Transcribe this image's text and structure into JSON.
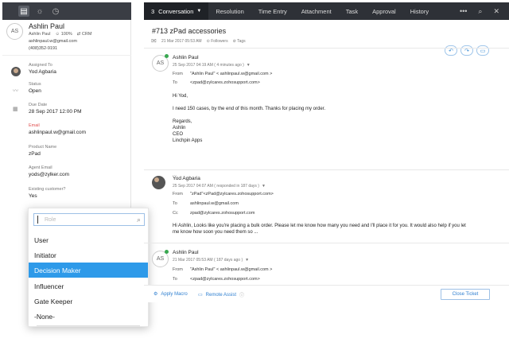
{
  "topbar": {
    "left_icons": [
      "ticket-icon",
      "bulb-icon",
      "history-icon"
    ],
    "tabs": [
      {
        "count": "3",
        "label": "Conversation",
        "active": true
      },
      {
        "label": "Resolution"
      },
      {
        "label": "Time Entry"
      },
      {
        "label": "Attachment"
      },
      {
        "label": "Task"
      },
      {
        "label": "Approval"
      },
      {
        "label": "History"
      }
    ],
    "more_icon": "•••",
    "search_icon": "⌕",
    "close_icon": "✕"
  },
  "customer": {
    "initials": "AS",
    "name": "Ashlin Paul",
    "short_name": "Ashlin Paul",
    "score": "100%",
    "crm": "CRM",
    "email": "ashlinpaul.w@gmail.com",
    "phone": "(408)352-9191"
  },
  "fields": [
    {
      "label": "Assigned To",
      "value": "Yod Agbaria"
    },
    {
      "label": "Status",
      "value": "Open"
    },
    {
      "label": "Due Date",
      "value": "28 Sep 2017 12:00 PM"
    },
    {
      "label": "Email",
      "value": "ashlinpaul.w@gmail.com"
    },
    {
      "label": "Product Name",
      "value": "zPad"
    },
    {
      "label": "Agent Email",
      "value": "yods@zylker.com"
    },
    {
      "label": "Existing customer?",
      "value": "Yes"
    }
  ],
  "dropdown": {
    "placeholder": "Role",
    "options": [
      "User",
      "Initiator",
      "Decision Maker",
      "Influencer",
      "Gate Keeper",
      "-None-"
    ],
    "selected": "Decision Maker"
  },
  "ticket": {
    "number": "#713",
    "subject": "zPad accessories",
    "date": "21 Mar 2017 05:53 AM",
    "followers": "Followers",
    "tags": "Tags"
  },
  "messages": [
    {
      "initials": "AS",
      "sender": "Ashlin Paul",
      "when": "25 Sep 2017 04:19 AM ( 4 minutes ago )",
      "from": "\"Ashlin Paul\" < ashlinpaul.w@gmail.com >",
      "to": "<zpad@zylcares.zohosupport.com>",
      "body": [
        "Hi Yod,",
        "",
        "I need 150 cases, by the end of this month. Thanks for placing my order.",
        "",
        "Regards,",
        "Ashlin",
        "CEO",
        "Linchpin Apps"
      ],
      "ellipsis": "..."
    },
    {
      "sender": "Yod Agbaria",
      "when": "25 Sep 2017 04:07 AM ( responded in 187 days )",
      "from": "\"zPad\"<zPad@zylcares.zohosupport.com>",
      "to": "ashlinpaul.w@gmail.com",
      "cc": "zpad@zylcares.zohosupport.com",
      "body": [
        "Hi Ashlin, Looks like you're placing a bulk order. Please let me know how many you need and I'll place it for you. It would also help if you let",
        "me know how soon you need them so ..."
      ]
    },
    {
      "initials": "AS",
      "sender": "Ashlin Paul",
      "when": "21 Mar 2017 05:53 AM ( 187 days ago )",
      "from": "\"Ashlin Paul\" < ashlinpaul.w@gmail.com >",
      "to": "<zpad@zylcares.zohosupport.com>"
    }
  ],
  "labels": {
    "from": "From",
    "to": "To",
    "cc": "Cc"
  },
  "actions": {
    "apply_macro": "Apply Macro",
    "remote_assist": "Remote Assist",
    "close_ticket": "Close Ticket"
  },
  "colors": {
    "accent": "#2e9ae9",
    "topbar": "#2e3137",
    "online": "#39a850"
  }
}
